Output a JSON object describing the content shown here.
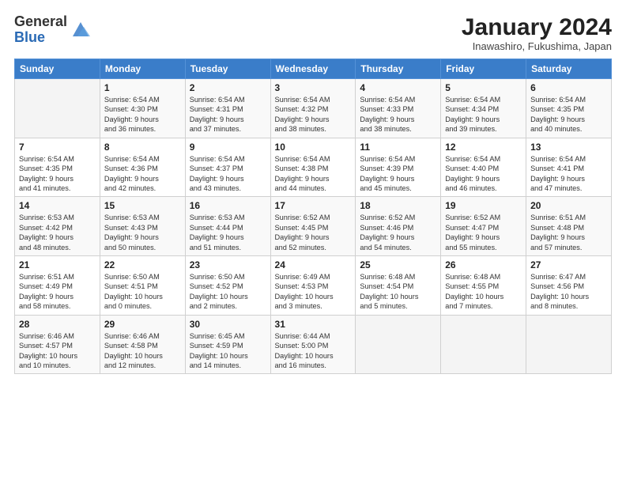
{
  "logo": {
    "general": "General",
    "blue": "Blue"
  },
  "title": {
    "month_year": "January 2024",
    "location": "Inawashiro, Fukushima, Japan"
  },
  "headers": [
    "Sunday",
    "Monday",
    "Tuesday",
    "Wednesday",
    "Thursday",
    "Friday",
    "Saturday"
  ],
  "weeks": [
    [
      {
        "num": "",
        "info": ""
      },
      {
        "num": "1",
        "info": "Sunrise: 6:54 AM\nSunset: 4:30 PM\nDaylight: 9 hours\nand 36 minutes."
      },
      {
        "num": "2",
        "info": "Sunrise: 6:54 AM\nSunset: 4:31 PM\nDaylight: 9 hours\nand 37 minutes."
      },
      {
        "num": "3",
        "info": "Sunrise: 6:54 AM\nSunset: 4:32 PM\nDaylight: 9 hours\nand 38 minutes."
      },
      {
        "num": "4",
        "info": "Sunrise: 6:54 AM\nSunset: 4:33 PM\nDaylight: 9 hours\nand 38 minutes."
      },
      {
        "num": "5",
        "info": "Sunrise: 6:54 AM\nSunset: 4:34 PM\nDaylight: 9 hours\nand 39 minutes."
      },
      {
        "num": "6",
        "info": "Sunrise: 6:54 AM\nSunset: 4:35 PM\nDaylight: 9 hours\nand 40 minutes."
      }
    ],
    [
      {
        "num": "7",
        "info": "Sunrise: 6:54 AM\nSunset: 4:35 PM\nDaylight: 9 hours\nand 41 minutes."
      },
      {
        "num": "8",
        "info": "Sunrise: 6:54 AM\nSunset: 4:36 PM\nDaylight: 9 hours\nand 42 minutes."
      },
      {
        "num": "9",
        "info": "Sunrise: 6:54 AM\nSunset: 4:37 PM\nDaylight: 9 hours\nand 43 minutes."
      },
      {
        "num": "10",
        "info": "Sunrise: 6:54 AM\nSunset: 4:38 PM\nDaylight: 9 hours\nand 44 minutes."
      },
      {
        "num": "11",
        "info": "Sunrise: 6:54 AM\nSunset: 4:39 PM\nDaylight: 9 hours\nand 45 minutes."
      },
      {
        "num": "12",
        "info": "Sunrise: 6:54 AM\nSunset: 4:40 PM\nDaylight: 9 hours\nand 46 minutes."
      },
      {
        "num": "13",
        "info": "Sunrise: 6:54 AM\nSunset: 4:41 PM\nDaylight: 9 hours\nand 47 minutes."
      }
    ],
    [
      {
        "num": "14",
        "info": "Sunrise: 6:53 AM\nSunset: 4:42 PM\nDaylight: 9 hours\nand 48 minutes."
      },
      {
        "num": "15",
        "info": "Sunrise: 6:53 AM\nSunset: 4:43 PM\nDaylight: 9 hours\nand 50 minutes."
      },
      {
        "num": "16",
        "info": "Sunrise: 6:53 AM\nSunset: 4:44 PM\nDaylight: 9 hours\nand 51 minutes."
      },
      {
        "num": "17",
        "info": "Sunrise: 6:52 AM\nSunset: 4:45 PM\nDaylight: 9 hours\nand 52 minutes."
      },
      {
        "num": "18",
        "info": "Sunrise: 6:52 AM\nSunset: 4:46 PM\nDaylight: 9 hours\nand 54 minutes."
      },
      {
        "num": "19",
        "info": "Sunrise: 6:52 AM\nSunset: 4:47 PM\nDaylight: 9 hours\nand 55 minutes."
      },
      {
        "num": "20",
        "info": "Sunrise: 6:51 AM\nSunset: 4:48 PM\nDaylight: 9 hours\nand 57 minutes."
      }
    ],
    [
      {
        "num": "21",
        "info": "Sunrise: 6:51 AM\nSunset: 4:49 PM\nDaylight: 9 hours\nand 58 minutes."
      },
      {
        "num": "22",
        "info": "Sunrise: 6:50 AM\nSunset: 4:51 PM\nDaylight: 10 hours\nand 0 minutes."
      },
      {
        "num": "23",
        "info": "Sunrise: 6:50 AM\nSunset: 4:52 PM\nDaylight: 10 hours\nand 2 minutes."
      },
      {
        "num": "24",
        "info": "Sunrise: 6:49 AM\nSunset: 4:53 PM\nDaylight: 10 hours\nand 3 minutes."
      },
      {
        "num": "25",
        "info": "Sunrise: 6:48 AM\nSunset: 4:54 PM\nDaylight: 10 hours\nand 5 minutes."
      },
      {
        "num": "26",
        "info": "Sunrise: 6:48 AM\nSunset: 4:55 PM\nDaylight: 10 hours\nand 7 minutes."
      },
      {
        "num": "27",
        "info": "Sunrise: 6:47 AM\nSunset: 4:56 PM\nDaylight: 10 hours\nand 8 minutes."
      }
    ],
    [
      {
        "num": "28",
        "info": "Sunrise: 6:46 AM\nSunset: 4:57 PM\nDaylight: 10 hours\nand 10 minutes."
      },
      {
        "num": "29",
        "info": "Sunrise: 6:46 AM\nSunset: 4:58 PM\nDaylight: 10 hours\nand 12 minutes."
      },
      {
        "num": "30",
        "info": "Sunrise: 6:45 AM\nSunset: 4:59 PM\nDaylight: 10 hours\nand 14 minutes."
      },
      {
        "num": "31",
        "info": "Sunrise: 6:44 AM\nSunset: 5:00 PM\nDaylight: 10 hours\nand 16 minutes."
      },
      {
        "num": "",
        "info": ""
      },
      {
        "num": "",
        "info": ""
      },
      {
        "num": "",
        "info": ""
      }
    ]
  ]
}
